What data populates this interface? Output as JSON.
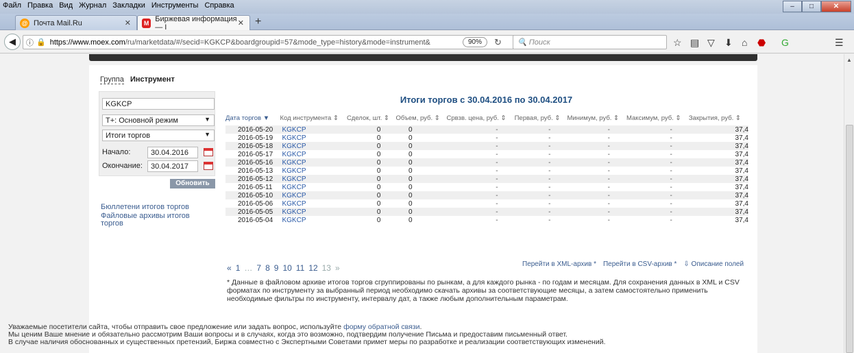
{
  "browser": {
    "menu": [
      "Файл",
      "Правка",
      "Вид",
      "Журнал",
      "Закладки",
      "Инструменты",
      "Справка"
    ],
    "tabs": [
      {
        "label": "Почта Mail.Ru"
      },
      {
        "label": "Биржевая информация — I"
      }
    ],
    "url_domain": "https://www.moex.com",
    "url_rest": "/ru/marketdata/#/secid=KGKCP&boardgroupid=57&mode_type=history&mode=instrument&",
    "zoom": "90%",
    "search_placeholder": "Поиск",
    "window_min": "–",
    "window_max": "□",
    "window_close": "✕"
  },
  "sidebar": {
    "tab_group": "Группа",
    "tab_instrument": "Инструмент",
    "ticker": "KGKCP",
    "mode": "Т+: Основной режим",
    "report": "Итоги торгов",
    "start_label": "Начало:",
    "start_value": "30.04.2016",
    "end_label": "Окончание:",
    "end_value": "30.04.2017",
    "update_button": "Обновить",
    "link_bulletins": "Бюллетени итогов торгов",
    "link_archives": "Файловые архивы итогов торгов"
  },
  "table": {
    "title": "Итоги торгов с 30.04.2016 по 30.04.2017",
    "headers": [
      "Дата торгов ▼",
      "Код инструмента ⇕",
      "Сделок, шт. ⇕",
      "Объем, руб. ⇕",
      "Срвзв. цена, руб. ⇕",
      "Первая, руб. ⇕",
      "Минимум, руб. ⇕",
      "Максимум, руб. ⇕",
      "Закрытия, руб. ⇕"
    ],
    "rows": [
      [
        "2016-05-20",
        "KGKCP",
        "0",
        "0",
        "-",
        "-",
        "-",
        "-",
        "37,4"
      ],
      [
        "2016-05-19",
        "KGKCP",
        "0",
        "0",
        "-",
        "-",
        "-",
        "-",
        "37,4"
      ],
      [
        "2016-05-18",
        "KGKCP",
        "0",
        "0",
        "-",
        "-",
        "-",
        "-",
        "37,4"
      ],
      [
        "2016-05-17",
        "KGKCP",
        "0",
        "0",
        "-",
        "-",
        "-",
        "-",
        "37,4"
      ],
      [
        "2016-05-16",
        "KGKCP",
        "0",
        "0",
        "-",
        "-",
        "-",
        "-",
        "37,4"
      ],
      [
        "2016-05-13",
        "KGKCP",
        "0",
        "0",
        "-",
        "-",
        "-",
        "-",
        "37,4"
      ],
      [
        "2016-05-12",
        "KGKCP",
        "0",
        "0",
        "-",
        "-",
        "-",
        "-",
        "37,4"
      ],
      [
        "2016-05-11",
        "KGKCP",
        "0",
        "0",
        "-",
        "-",
        "-",
        "-",
        "37,4"
      ],
      [
        "2016-05-10",
        "KGKCP",
        "0",
        "0",
        "-",
        "-",
        "-",
        "-",
        "37,4"
      ],
      [
        "2016-05-06",
        "KGKCP",
        "0",
        "0",
        "-",
        "-",
        "-",
        "-",
        "37,4"
      ],
      [
        "2016-05-05",
        "KGKCP",
        "0",
        "0",
        "-",
        "-",
        "-",
        "-",
        "37,4"
      ],
      [
        "2016-05-04",
        "KGKCP",
        "0",
        "0",
        "-",
        "-",
        "-",
        "-",
        "37,4"
      ]
    ]
  },
  "pager": {
    "prev": "«",
    "first": "1",
    "ellipsis": "…",
    "pages": [
      "7",
      "8",
      "9",
      "10",
      "11",
      "12",
      "13"
    ],
    "next": "»"
  },
  "archive": {
    "xml": "Перейти в XML-архив *",
    "csv": "Перейти в CSV-архив *",
    "fields": "⇩ Описание полей"
  },
  "footnote": "* Данные в файловом архиве итогов торгов сгруппированы по рынкам, а для каждого рынка - по годам и месяцам. Для сохранения данных в XML и CSV форматах по инструменту за выбранный период необходимо скачать архивы за соответствующие месяцы, а затем самостоятельно применить необходимые фильтры по инструменту, интервалу дат, а также любым дополнительным параметрам.",
  "contact": {
    "line1_prefix": "Уважаемые посетители сайта, чтобы отправить свое предложение или задать вопрос, используйте ",
    "line1_link": "форму обратной связи",
    "line1_suffix": ".",
    "line2": "Мы ценим Ваше мнение и обязательно рассмотрим Ваши вопросы и в случаях, когда это возможно, подтвердим получение Письма и предоставим письменный ответ.",
    "line3": "В случае наличия обоснованных и существенных претензий, Биржа совместно с Экспертными Советами примет меры по разработке и реализации соответствующих изменений."
  }
}
